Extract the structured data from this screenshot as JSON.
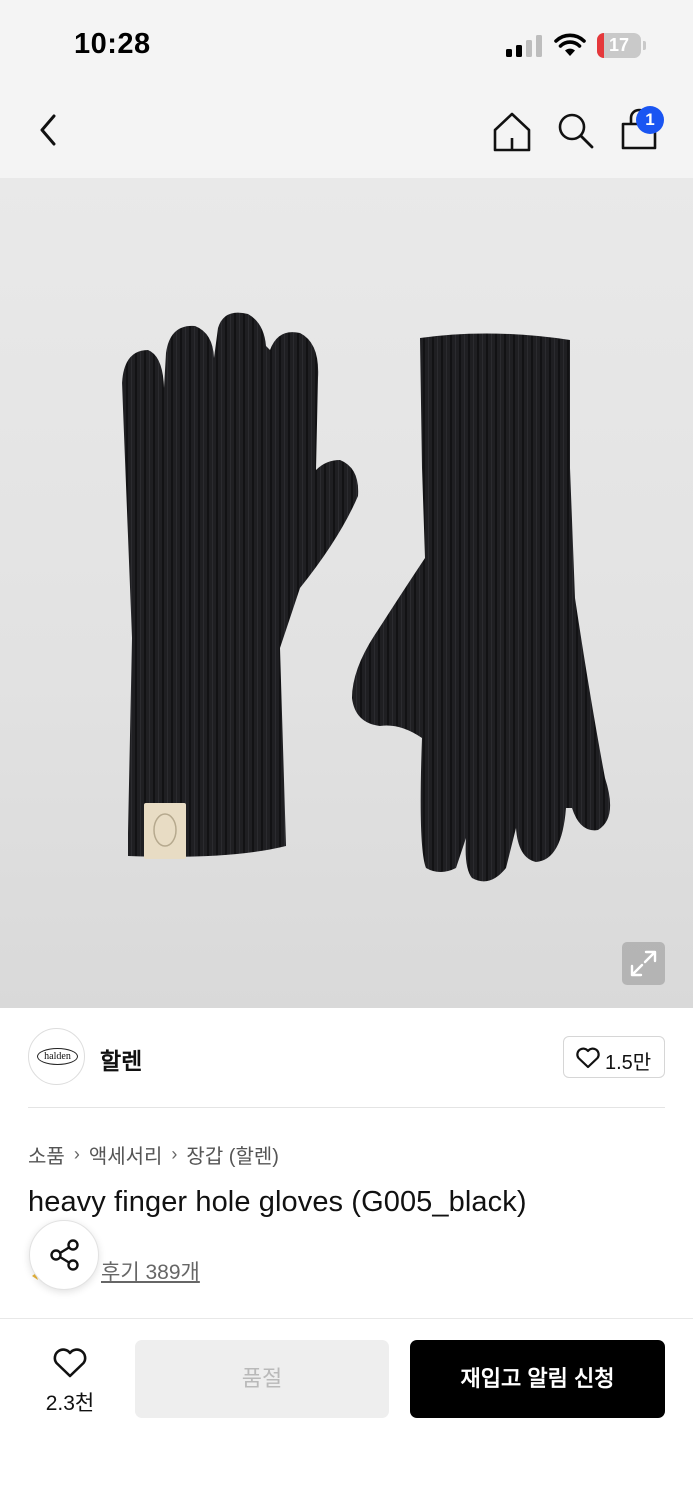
{
  "status_bar": {
    "time": "10:28",
    "battery_level": "17",
    "battery_color": "#e5383b",
    "signal_icon": "cellular-signal-icon",
    "wifi_icon": "wifi-icon"
  },
  "nav": {
    "back_icon": "chevron-left-icon",
    "home_icon": "home-icon",
    "search_icon": "search-icon",
    "cart_icon": "shopping-bag-icon",
    "cart_count": "1",
    "badge_color": "#1a55f2"
  },
  "product_image": {
    "subject": "black knit gloves photo",
    "expand_icon": "expand-arrows-icon",
    "glove_label": "halden"
  },
  "brand": {
    "logo_text": "halden",
    "name": "할렌",
    "like_icon": "heart-outline-icon",
    "like_count": "1.5만"
  },
  "breadcrumb": [
    "소품",
    "액세서리",
    "장갑 (할렌)"
  ],
  "product": {
    "title": "heavy finger hole gloves (G005_black)",
    "review_link": "후기 389개"
  },
  "share": {
    "icon": "share-icon"
  },
  "bottom_bar": {
    "wish_icon": "heart-outline-icon",
    "wish_count": "2.3천",
    "soldout_label": "품절",
    "restock_label": "재입고 알림 신청"
  }
}
